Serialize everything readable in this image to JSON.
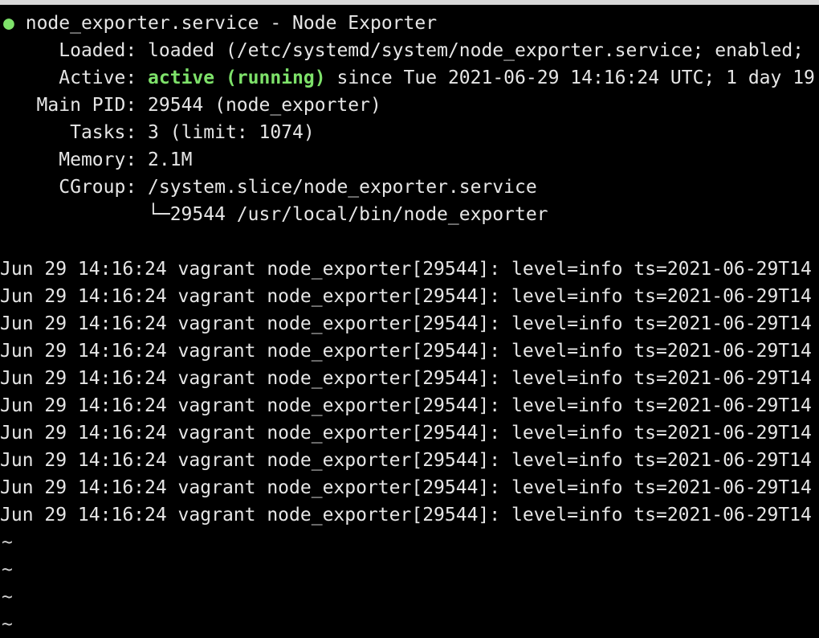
{
  "status": {
    "bullet": "●",
    "title": "node_exporter.service - Node Exporter",
    "loaded_label": "Loaded:",
    "loaded_value": "loaded (/etc/systemd/system/node_exporter.service; enabled;",
    "active_label": "Active:",
    "active_state": "active (running)",
    "active_since": "since Tue 2021-06-29 14:16:24 UTC; 1 day 19",
    "pid_label": "Main PID:",
    "pid_value": "29544 (node_exporter)",
    "tasks_label": "Tasks:",
    "tasks_value": "3 (limit: 1074)",
    "memory_label": "Memory:",
    "memory_value": "2.1M",
    "cgroup_label": "CGroup:",
    "cgroup_value": "/system.slice/node_exporter.service",
    "cgroup_child": "└─29544 /usr/local/bin/node_exporter"
  },
  "log_lines": [
    "Jun 29 14:16:24 vagrant node_exporter[29544]: level=info ts=2021-06-29T14",
    "Jun 29 14:16:24 vagrant node_exporter[29544]: level=info ts=2021-06-29T14",
    "Jun 29 14:16:24 vagrant node_exporter[29544]: level=info ts=2021-06-29T14",
    "Jun 29 14:16:24 vagrant node_exporter[29544]: level=info ts=2021-06-29T14",
    "Jun 29 14:16:24 vagrant node_exporter[29544]: level=info ts=2021-06-29T14",
    "Jun 29 14:16:24 vagrant node_exporter[29544]: level=info ts=2021-06-29T14",
    "Jun 29 14:16:24 vagrant node_exporter[29544]: level=info ts=2021-06-29T14",
    "Jun 29 14:16:24 vagrant node_exporter[29544]: level=info ts=2021-06-29T14",
    "Jun 29 14:16:24 vagrant node_exporter[29544]: level=info ts=2021-06-29T14",
    "Jun 29 14:16:24 vagrant node_exporter[29544]: level=info ts=2021-06-29T14"
  ],
  "pager": {
    "tilde_lines": [
      "~",
      "~",
      "~",
      "~"
    ]
  },
  "colors": {
    "background": "#000000",
    "text": "#e6e6e6",
    "active_green": "#7ee26a"
  }
}
